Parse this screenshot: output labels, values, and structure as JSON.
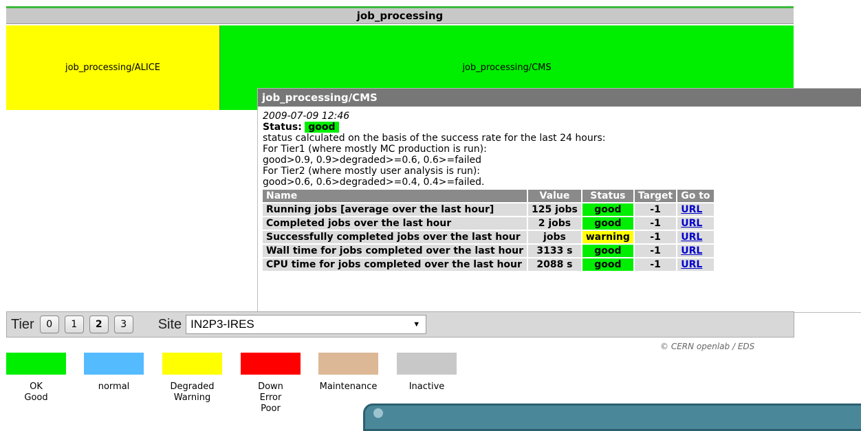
{
  "map": {
    "title": "job_processing",
    "cells": [
      {
        "label": "job_processing/ALICE",
        "status_color": "#ffff00"
      },
      {
        "label": "job_processing/CMS",
        "status_color": "#00ee00"
      }
    ]
  },
  "tooltip": {
    "title": "job_processing/CMS",
    "date": "2009-07-09 12:46",
    "status_label": "Status:",
    "status_value": "good",
    "lines": [
      "status calculated on the basis of the success rate for the last 24 hours:",
      "For Tier1 (where mostly MC production is run):",
      "good>0.9, 0.9>degraded>=0.6, 0.6>=failed",
      "For Tier2 (where mostly user analysis is run):",
      "good>0.6, 0.6>degraded>=0.4, 0.4>=failed."
    ],
    "table": {
      "headers": [
        "Name",
        "Value",
        "Status",
        "Target",
        "Go to"
      ],
      "rows": [
        {
          "name": "Running jobs [average over the last hour]",
          "value": "125 jobs",
          "status": "good",
          "target": "-1",
          "link": "URL"
        },
        {
          "name": "Completed jobs over the last hour",
          "value": "2 jobs",
          "status": "good",
          "target": "-1",
          "link": "URL"
        },
        {
          "name": "Successfully completed jobs over the last hour",
          "value": "jobs",
          "status": "warning",
          "target": "-1",
          "link": "URL"
        },
        {
          "name": "Wall time for jobs completed over the last hour",
          "value": "3133 s",
          "status": "good",
          "target": "-1",
          "link": "URL"
        },
        {
          "name": "CPU time for jobs completed over the last hour",
          "value": "2088 s",
          "status": "good",
          "target": "-1",
          "link": "URL"
        }
      ]
    }
  },
  "controls": {
    "tier_label": "Tier",
    "tiers": [
      "0",
      "1",
      "2",
      "3"
    ],
    "selected_tier": "2",
    "site_label": "Site",
    "site_value": "IN2P3-IRES"
  },
  "copyright": "© CERN openlab / EDS",
  "legend": [
    {
      "color": "#00ee00",
      "label": "OK\nGood"
    },
    {
      "color": "#55bbff",
      "label": "normal"
    },
    {
      "color": "#ffff00",
      "label": "Degraded\nWarning"
    },
    {
      "color": "#ff0000",
      "label": "Down\nError\nPoor"
    },
    {
      "color": "#dcb896",
      "label": "Maintenance"
    },
    {
      "color": "#c8c8c8",
      "label": "Inactive"
    }
  ]
}
